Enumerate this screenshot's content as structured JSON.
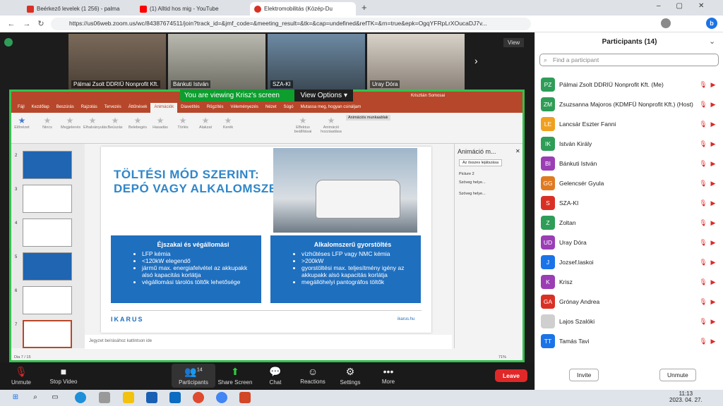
{
  "browser": {
    "tabs": [
      {
        "label": "Beérkező levelek (1 256) - palma",
        "color": "#d93025"
      },
      {
        "label": "(1) Alltid hos mig - YouTube",
        "color": "#ff0000"
      },
      {
        "label": "Elektromobilitás (Közép-Du",
        "color": "#d93025"
      }
    ],
    "url": "https://us06web.zoom.us/wc/84387674511/join?track_id=&jmf_code=&meeting_result=&tk=&cap=undefined&refTK=&rn=true&epk=OgqYFRpLrXOucaDJ7v..."
  },
  "zoom": {
    "view_label": "View",
    "video_tiles": [
      {
        "name": "Pálmai Zsolt DDRIÜ Nonprofit Kft."
      },
      {
        "name": "Bánkuti István"
      },
      {
        "name": "SZA-KI"
      },
      {
        "name": "Uray Dóra"
      }
    ],
    "banner": "You are viewing Krisz's screen",
    "view_options": "View Options",
    "toolbar": {
      "unmute": "Unmute",
      "stop_video": "Stop Video",
      "participants": "Participants",
      "participants_count": "14",
      "share_screen": "Share Screen",
      "chat": "Chat",
      "reactions": "Reactions",
      "settings": "Settings",
      "more": "More",
      "leave": "Leave"
    }
  },
  "ppt": {
    "presenter": "Krisztián Somosai",
    "menu": [
      "Fájl",
      "Kezdőlap",
      "Beszúrás",
      "Rajzolás",
      "Tervezés",
      "Áttűnések",
      "Animációk",
      "Diavetítés",
      "Rögzítés",
      "Véleményezés",
      "Nézet",
      "Súgó",
      "Mutassa meg, hogyan csináljam"
    ],
    "active_menu": "Animációk",
    "ribbon": [
      "Nincs",
      "Megjelenés",
      "Elhalványulás",
      "Beúszás",
      "Belebegés",
      "Hasadás",
      "Törlés",
      "Alakzat",
      "Kerék"
    ],
    "ribbon_left": "Előnézet",
    "ribbon_right": [
      "Effektus beállításai",
      "Animáció hozzáadása"
    ],
    "anim_panel_btn": "Animációs munkaablak",
    "slide": {
      "title_line1": "TÖLTÉSI MÓD SZERINT:",
      "title_line2": "DEPÓ VAGY ALKALOMSZERŰ",
      "left_box": {
        "heading": "Éjszakai és végállomási",
        "items": [
          "LFP kémia",
          "<120kW elegendő",
          "jármű max. energiafelvétel az akkupakk alsó kapacitás korlátja",
          "végállomási tárolós töltők lehetősége"
        ]
      },
      "right_box": {
        "heading": "Alkalomszerű gyorstöltés",
        "items": [
          "vízhűtéses LFP vagy NMC kémia",
          ">200kW",
          "gyorstöltési max. teljesítmény igény az akkupakk alsó kapacitás korlátja",
          "megállóhelyi pantográfos töltők"
        ]
      },
      "logo": "IKARUS",
      "site": "ikarus.hu"
    },
    "anim_pane": {
      "title": "Animáció m...",
      "play_btn": "Az összes lejátszása",
      "items": [
        "Picture 2",
        "Szöveg helye...",
        "Szöveg helye..."
      ]
    },
    "notes": "Jegyzet beírásához kattintson ide",
    "status": "Dia 7 / 15",
    "zoom_level": "71%"
  },
  "participants": {
    "title": "Participants (14)",
    "search_placeholder": "Find a participant",
    "list": [
      {
        "initials": "PZ",
        "name": "Pálmai Zsolt DDRIÜ Nonprofit Kft. (Me)",
        "color": "#2e9d57"
      },
      {
        "initials": "ZM",
        "name": "Zsuzsanna Majoros (KDMFÜ Nonprofit Kft.) (Host)",
        "color": "#2e9d57"
      },
      {
        "initials": "LE",
        "name": "Lancsár Eszter Fanni",
        "color": "#f0a020"
      },
      {
        "initials": "IK",
        "name": "István Király",
        "color": "#2e9d57"
      },
      {
        "initials": "BI",
        "name": "Bánkuti István",
        "color": "#9b3db5"
      },
      {
        "initials": "GG",
        "name": "Gelencsér Gyula",
        "color": "#e07a22"
      },
      {
        "initials": "S",
        "name": "SZA-KI",
        "color": "#d93025"
      },
      {
        "initials": "Z",
        "name": "Zoltan",
        "color": "#2e9d57"
      },
      {
        "initials": "UD",
        "name": "Uray Dóra",
        "color": "#9b3db5"
      },
      {
        "initials": "J",
        "name": "Jozsef.laskoi",
        "color": "#1a73e8"
      },
      {
        "initials": "K",
        "name": "Krisz",
        "color": "#9b3db5"
      },
      {
        "initials": "GA",
        "name": "Grónay Andrea",
        "color": "#d93025"
      },
      {
        "initials": "",
        "name": "Lajos Szalóki",
        "color": "#cfcfcf"
      },
      {
        "initials": "TT",
        "name": "Tamás Tavi",
        "color": "#1a73e8"
      }
    ],
    "invite": "Invite",
    "unmute_all": "Unmute"
  },
  "taskbar": {
    "time": "11:13",
    "date": "2023. 04. 27."
  }
}
